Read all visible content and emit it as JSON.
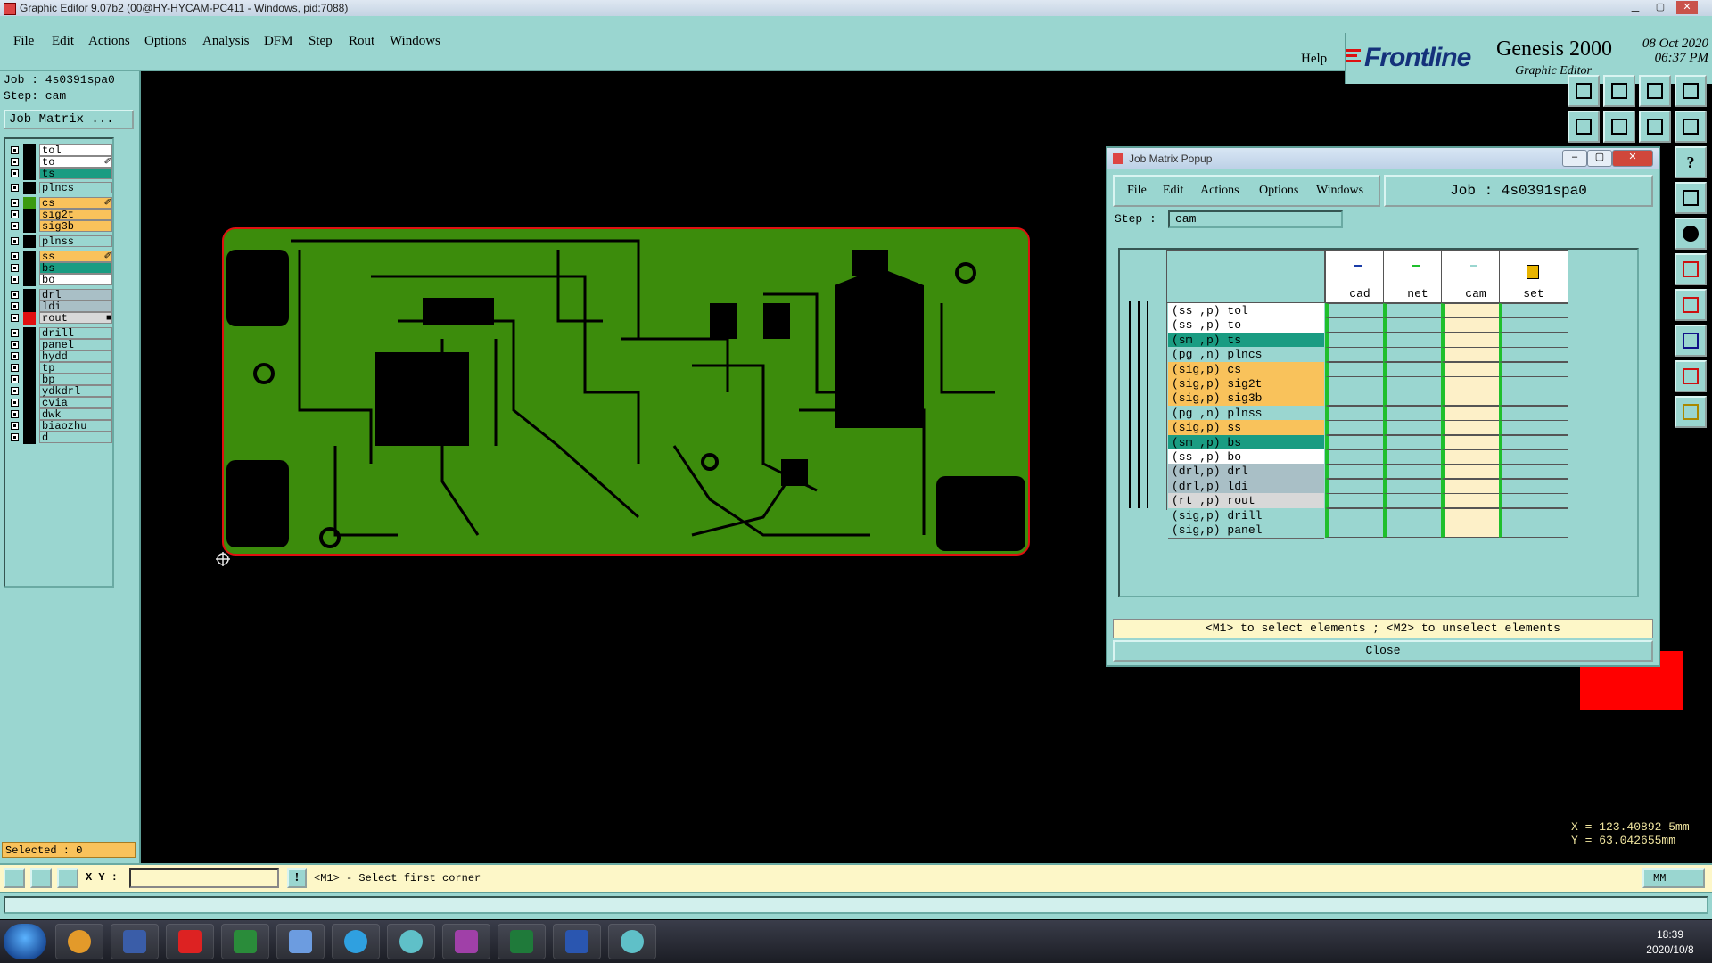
{
  "window": {
    "title": "Graphic Editor 9.07b2 (00@HY-HYCAM-PC411 - Windows, pid:7088)"
  },
  "menu": [
    "File",
    "Edit",
    "Actions",
    "Options",
    "Analysis",
    "DFM",
    "Step",
    "Rout",
    "Windows"
  ],
  "help": "Help",
  "brand": {
    "name": "Frontline",
    "product": "Genesis 2000",
    "subtitle": "Graphic Editor",
    "date": "08 Oct 2020",
    "time": "06:37 PM"
  },
  "left": {
    "job": "Job : 4s0391spa0",
    "step": "Step: cam",
    "job_matrix_button": "Job Matrix ...",
    "selected": "Selected : 0",
    "layers": [
      {
        "name": "tol",
        "color": "#000000",
        "bg": "#ffffff"
      },
      {
        "name": "to",
        "color": "#000000",
        "bg": "#ffffff",
        "mark": "✐"
      },
      {
        "name": "ts",
        "color": "#000000",
        "bg": "#1a9c82"
      },
      {
        "name": "plncs",
        "color": "#000000",
        "bg": "#9ad6d0"
      },
      {
        "name": "cs",
        "color": "#3a9a10",
        "bg": "#f9c25b",
        "mark": "✐"
      },
      {
        "name": "sig2t",
        "color": "#000000",
        "bg": "#f9c25b"
      },
      {
        "name": "sig3b",
        "color": "#000000",
        "bg": "#f9c25b"
      },
      {
        "name": "plnss",
        "color": "#000000",
        "bg": "#9ad6d0"
      },
      {
        "name": "ss",
        "color": "#000000",
        "bg": "#f9c25b",
        "mark": "✐"
      },
      {
        "name": "bs",
        "color": "#000000",
        "bg": "#1a9c82"
      },
      {
        "name": "bo",
        "color": "#000000",
        "bg": "#ffffff"
      },
      {
        "name": "drl",
        "color": "#000000",
        "bg": "#a9bfc6"
      },
      {
        "name": "ldi",
        "color": "#000000",
        "bg": "#a9bfc6"
      },
      {
        "name": "rout",
        "color": "#e01010",
        "bg": "#d8d8d8",
        "mark": "■"
      },
      {
        "name": "drill",
        "color": "#000000",
        "bg": "#9ad6d0"
      },
      {
        "name": "panel",
        "color": "#000000",
        "bg": "#9ad6d0"
      },
      {
        "name": "hydd",
        "color": "#000000",
        "bg": "#9ad6d0"
      },
      {
        "name": "tp",
        "color": "#000000",
        "bg": "#9ad6d0"
      },
      {
        "name": "bp",
        "color": "#000000",
        "bg": "#9ad6d0"
      },
      {
        "name": "ydkdrl",
        "color": "#000000",
        "bg": "#9ad6d0"
      },
      {
        "name": "cvia",
        "color": "#000000",
        "bg": "#9ad6d0"
      },
      {
        "name": "dwk",
        "color": "#000000",
        "bg": "#9ad6d0"
      },
      {
        "name": "biaozhu",
        "color": "#000000",
        "bg": "#9ad6d0"
      },
      {
        "name": "d",
        "color": "#000000",
        "bg": "#9ad6d0"
      }
    ]
  },
  "command": {
    "xy_label": "X Y :",
    "xy_value": "",
    "prompt": "<M1> - Select first corner",
    "unit": "MM"
  },
  "coords": {
    "x": "X = 123.40892 5mm",
    "y": "Y = 63.042655mm"
  },
  "popup": {
    "title": "Job Matrix Popup",
    "menu": [
      "File",
      "Edit",
      "Actions",
      "Options",
      "Windows"
    ],
    "job": "Job : 4s0391spa0",
    "step_label": "Step :",
    "step": "cam",
    "columns": [
      "cad",
      "net",
      "cam",
      "set"
    ],
    "rows": [
      {
        "label": "(ss ,p) tol",
        "bg": "#ffffff"
      },
      {
        "label": "(ss ,p) to",
        "bg": "#ffffff"
      },
      {
        "label": "(sm ,p) ts",
        "bg": "#1a9c82"
      },
      {
        "label": "(pg ,n) plncs",
        "bg": "#9ad6d0"
      },
      {
        "label": "(sig,p) cs",
        "bg": "#f9c25b"
      },
      {
        "label": "(sig,p) sig2t",
        "bg": "#f9c25b"
      },
      {
        "label": "(sig,p) sig3b",
        "bg": "#f9c25b"
      },
      {
        "label": "(pg ,n) plnss",
        "bg": "#9ad6d0"
      },
      {
        "label": "(sig,p) ss",
        "bg": "#f9c25b"
      },
      {
        "label": "(sm ,p) bs",
        "bg": "#1a9c82"
      },
      {
        "label": "(ss ,p) bo",
        "bg": "#ffffff"
      },
      {
        "label": "(drl,p) drl",
        "bg": "#a9bfc6"
      },
      {
        "label": "(drl,p) ldi",
        "bg": "#a9bfc6"
      },
      {
        "label": "(rt ,p) rout",
        "bg": "#d8d8d8"
      },
      {
        "label": "(sig,p) drill",
        "bg": "#9ad6d0"
      },
      {
        "label": "(sig,p) panel",
        "bg": "#9ad6d0"
      }
    ],
    "hint": "<M1> to select elements ; <M2> to unselect elements",
    "close": "Close"
  },
  "taskbar": {
    "time": "18:39",
    "date": "2020/10/8"
  },
  "colors": {
    "panel": "#9ad6d0",
    "board": "#3c8c0c",
    "outline": "#e01010",
    "selected": "#f9c25b"
  }
}
